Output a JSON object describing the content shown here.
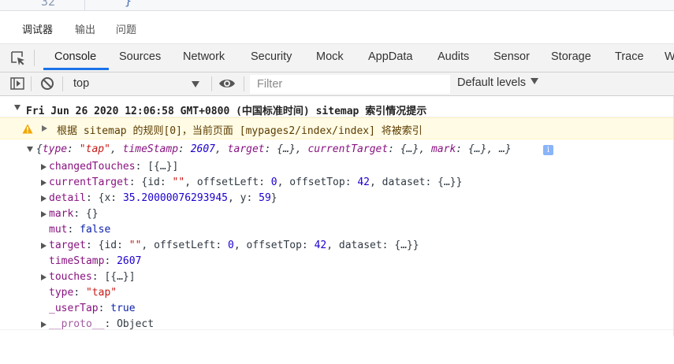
{
  "editor": {
    "line_number": "32",
    "brace": "}"
  },
  "top_tabs": [
    {
      "label": "调试器",
      "active": true
    },
    {
      "label": "输出",
      "active": false
    },
    {
      "label": "问题",
      "active": false
    }
  ],
  "panel_tabs": [
    {
      "label": "Console",
      "active": true
    },
    {
      "label": "Sources"
    },
    {
      "label": "Network"
    },
    {
      "label": "Security"
    },
    {
      "label": "Mock"
    },
    {
      "label": "AppData"
    },
    {
      "label": "Audits"
    },
    {
      "label": "Sensor"
    },
    {
      "label": "Storage"
    },
    {
      "label": "Trace"
    },
    {
      "label": "W"
    }
  ],
  "toolbar": {
    "context": "top",
    "filter_placeholder": "Filter",
    "levels_label": "Default levels"
  },
  "console": {
    "group_header": "Fri Jun 26 2020 12:06:58 GMT+0800 (中国标准时间) sitemap 索引情况提示",
    "warning": "根据 sitemap 的规则[0]，当前页面 [mypages2/index/index] 将被索引",
    "object_preview": {
      "open": "{",
      "k_type": "type",
      "v_type": "\"tap\"",
      "k_ts": "timeStamp",
      "v_ts": "2607",
      "k_target": "target",
      "v_target": "{…}",
      "k_ct": "currentTarget",
      "v_ct": "{…}",
      "k_mark": "mark",
      "v_mark": "{…}",
      "tail": "…}",
      "info": "i"
    },
    "props": {
      "changedTouches": {
        "key": "changedTouches",
        "val": "[{…}]"
      },
      "currentTarget": {
        "key": "currentTarget",
        "p1": "{id: ",
        "s1": "\"\"",
        "p2": ", offsetLeft: ",
        "n1": "0",
        "p3": ", offsetTop: ",
        "n2": "42",
        "p4": ", dataset: {…}}"
      },
      "detail": {
        "key": "detail",
        "p1": "{x: ",
        "n1": "35.20000076293945",
        "p2": ", y: ",
        "n2": "59",
        "p3": "}"
      },
      "mark": {
        "key": "mark",
        "val": "{}"
      },
      "mut": {
        "key": "mut",
        "val": "false"
      },
      "target": {
        "key": "target",
        "p1": "{id: ",
        "s1": "\"\"",
        "p2": ", offsetLeft: ",
        "n1": "0",
        "p3": ", offsetTop: ",
        "n2": "42",
        "p4": ", dataset: {…}}"
      },
      "timeStamp": {
        "key": "timeStamp",
        "val": "2607"
      },
      "touches": {
        "key": "touches",
        "val": "[{…}]"
      },
      "type": {
        "key": "type",
        "val": "\"tap\""
      },
      "userTap": {
        "key": "_userTap",
        "val": "true"
      },
      "proto": {
        "key": "__proto__",
        "val": "Object"
      }
    }
  }
}
